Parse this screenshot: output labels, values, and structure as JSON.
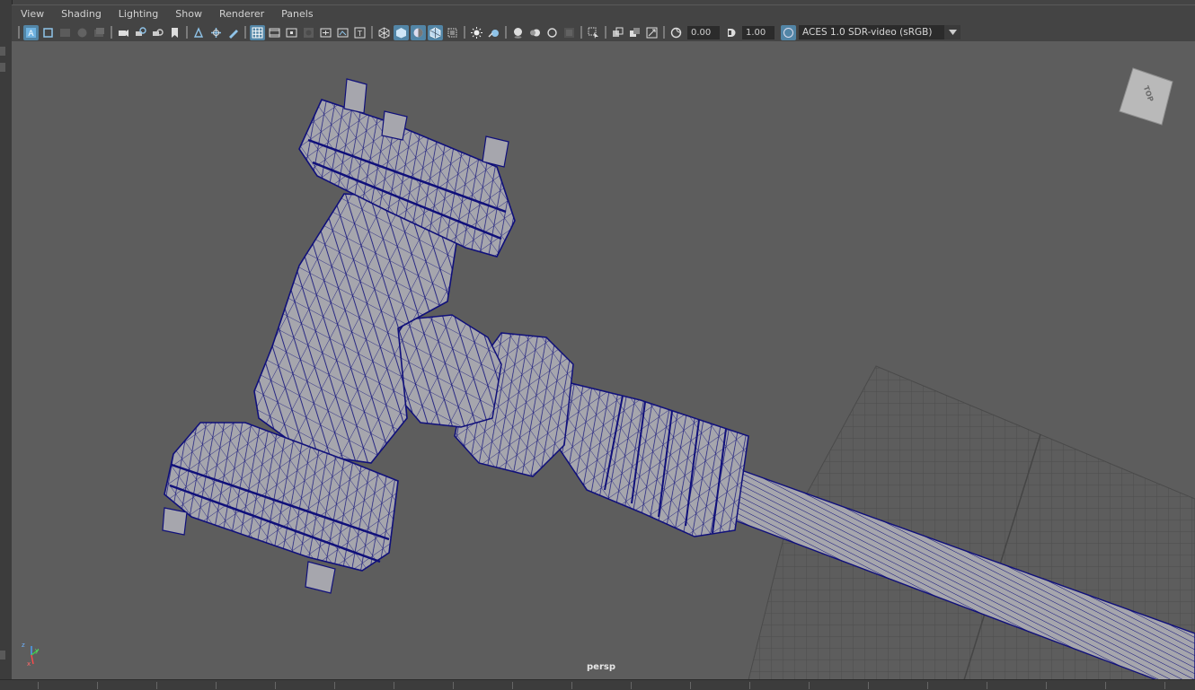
{
  "menu": {
    "items": [
      "View",
      "Shading",
      "Lighting",
      "Show",
      "Renderer",
      "Panels"
    ]
  },
  "toolbar": {
    "exposure_value": "0.00",
    "gamma_value": "1.00",
    "color_management": "ACES 1.0 SDR-video (sRGB)"
  },
  "viewport": {
    "camera_label": "persp",
    "view_cube_label": "TOP",
    "axis": {
      "x": "x",
      "y": "y",
      "z": "z"
    }
  },
  "colors": {
    "viewport_bg": "#5d5d5d",
    "wireframe": "#10107a",
    "shaded_surface": "#a6a6ad",
    "grid": "#4d4d4d",
    "active_button": "#5285a6"
  },
  "icons": {
    "toolbar": [
      "select-camera-icon",
      "camera-attributes-icon",
      "bookmark-icon",
      "image-plane-icon",
      "2d-pan-zoom-icon",
      "grease-pencil-icon",
      "grid-icon",
      "film-gate-icon",
      "resolution-gate-icon",
      "gate-mask-icon",
      "field-chart-icon",
      "safe-action-icon",
      "safe-title-icon",
      "wireframe-icon",
      "smooth-shade-icon",
      "default-material-icon",
      "wireframe-on-shaded-icon",
      "xray-icon",
      "use-all-lights-icon",
      "shadows-icon",
      "ssao-icon",
      "motion-blur-icon",
      "anti-aliasing-icon",
      "depth-of-field-icon",
      "isolate-select-icon",
      "xray-joints-icon",
      "xray-active-icon",
      "backface-culling-icon",
      "exposure-icon",
      "gamma-icon",
      "color-management-icon"
    ]
  }
}
